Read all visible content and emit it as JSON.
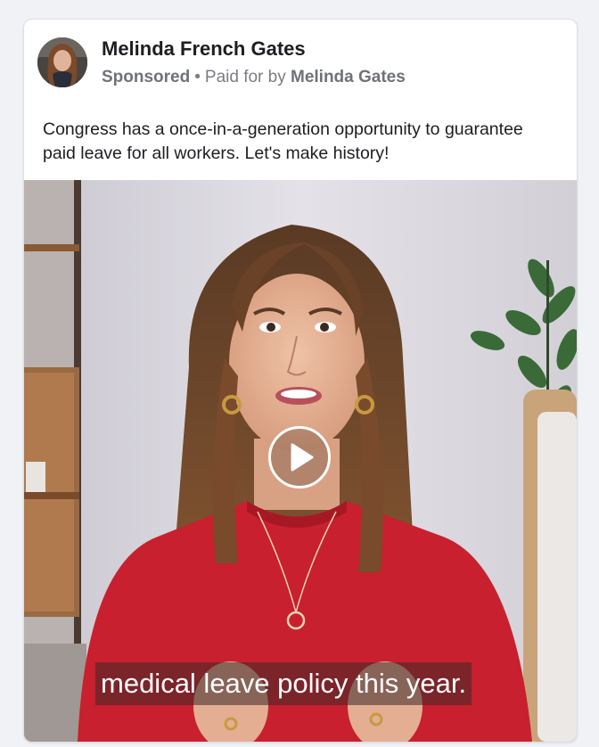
{
  "post": {
    "author_name": "Melinda French Gates",
    "sponsored_label": "Sponsored",
    "separator": "•",
    "paid_for_prefix": "Paid for by",
    "paid_for_name": "Melinda Gates",
    "caption": "Congress has a once-in-a-generation opportunity to guarantee paid leave for all workers. Let's make history!"
  },
  "video": {
    "subtitle": "medical leave policy this year.",
    "play_icon": "play-icon"
  },
  "colors": {
    "page_background": "#f0f2f5",
    "card_background": "#ffffff",
    "text_primary": "#1c1e21",
    "text_secondary": "#7a7d82",
    "sweater_red": "#c8202e"
  }
}
